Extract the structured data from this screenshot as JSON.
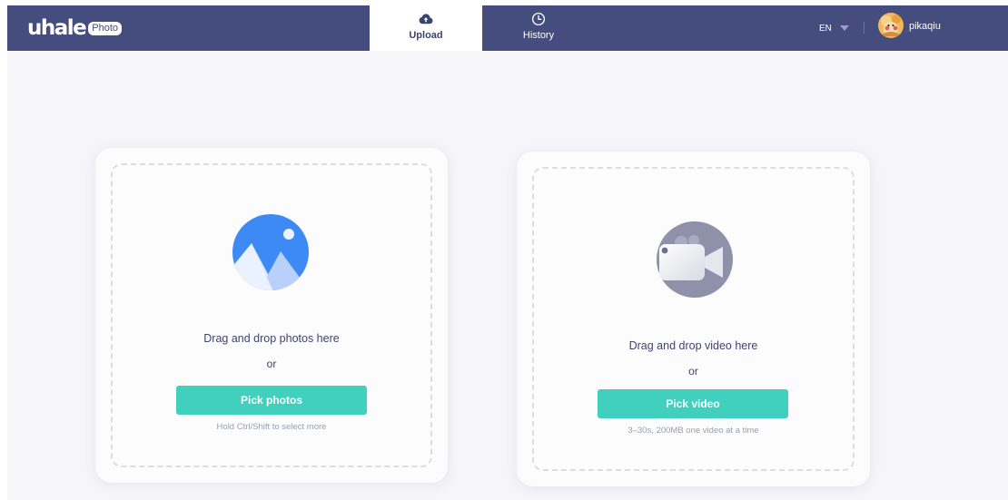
{
  "header": {
    "logo_text": "uhale",
    "logo_badge": "Photo",
    "tabs": [
      {
        "label": "Upload",
        "icon": "cloud-upload-icon",
        "active": true
      },
      {
        "label": "History",
        "icon": "clock-icon",
        "active": false
      }
    ],
    "language": "EN",
    "username": "pikaqiu",
    "colors": {
      "nav_bg": "#444d7e",
      "accent": "#42d0be"
    }
  },
  "photos_card": {
    "icon": "mountain-image-icon",
    "drop_text": "Drag and drop photos here",
    "or_text": "or",
    "button_label": "Pick photos",
    "hint": "Hold Ctrl/Shift to select more"
  },
  "video_card": {
    "icon": "video-camera-icon",
    "drop_text": "Drag and drop video here",
    "or_text": "or",
    "button_label": "Pick video",
    "hint": "3–30s, 200MB one video at a time"
  }
}
